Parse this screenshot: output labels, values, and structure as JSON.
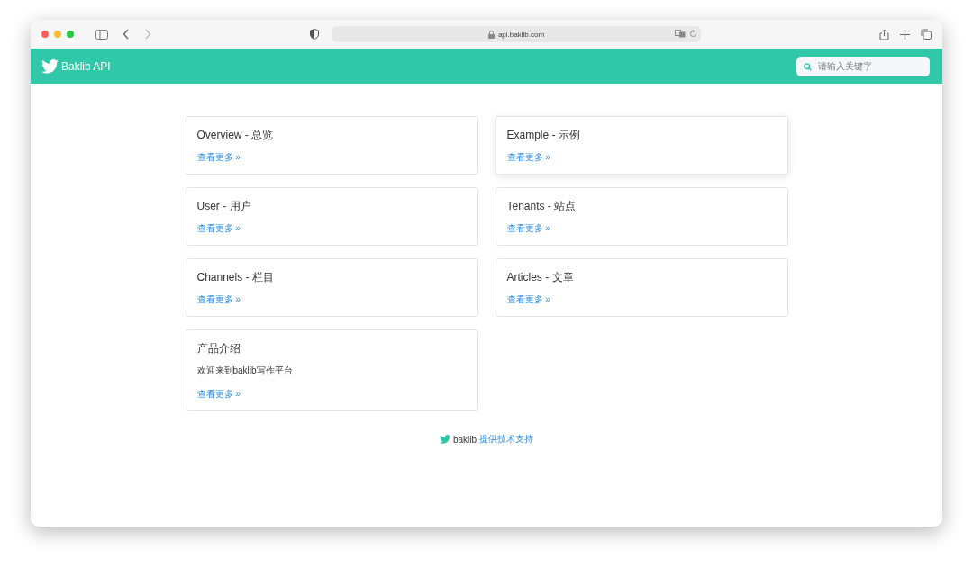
{
  "browser": {
    "url": "api.baklib.com"
  },
  "header": {
    "brand": "Baklib API",
    "search": {
      "placeholder": "请输入关键字"
    }
  },
  "cards": [
    {
      "title": "Overview - 总览",
      "link": "查看更多 »",
      "hovered": false
    },
    {
      "title": "Example - 示例",
      "link": "查看更多 »",
      "hovered": true
    },
    {
      "title": "User - 用户",
      "link": "查看更多 »",
      "hovered": false
    },
    {
      "title": "Tenants - 站点",
      "link": "查看更多 »",
      "hovered": false
    },
    {
      "title": "Channels - 栏目",
      "link": "查看更多 »",
      "hovered": false
    },
    {
      "title": "Articles - 文章",
      "link": "查看更多 »",
      "hovered": false
    },
    {
      "title": "产品介绍",
      "description": "欢迎来到baklib写作平台",
      "link": "查看更多 »",
      "hovered": false
    }
  ],
  "footer": {
    "brand": "baklib",
    "link": "提供技术支持"
  }
}
